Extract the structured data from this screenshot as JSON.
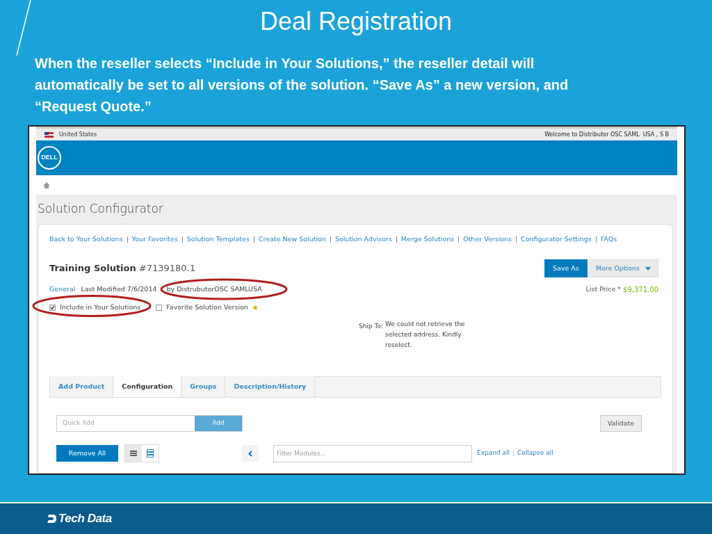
{
  "slide": {
    "title": "Deal Registration",
    "body": "When the reseller selects “Include in Your Solutions,” the reseller detail will automatically be set to all versions of the solution. “Save As” a new version, and “Request Quote.”",
    "footer_logo": "Tech Data"
  },
  "app": {
    "country": "United States",
    "welcome": "Welcome to Distributor OSC SAML  USA , S B",
    "logo": "DELL",
    "page_title": "Solution Configurator",
    "nav_links": [
      "Back to Your Solutions",
      "Your Favorites",
      "Solution Templates",
      "Create New Solution",
      "Solution Advisors",
      "Merge Solutions",
      "Other Versions",
      "Configurator Settings",
      "FAQs"
    ],
    "solution_name": "Training Solution",
    "solution_number": "#7139180.1",
    "general_link": "General",
    "last_modified": "Last Modified 7/6/2014",
    "modified_by": "by DistrubutorOSC SAMLUSA",
    "checkboxes": [
      {
        "label": "Include in Your Solutions",
        "checked": true,
        "starred": false
      },
      {
        "label": "Favorite Solution Version",
        "checked": false,
        "starred": true
      }
    ],
    "save_as": "Save As",
    "more_options": "More Options",
    "list_price_label": "List Price *",
    "list_price": "$9,371.00",
    "ship_to": {
      "label": "Ship To:",
      "message": "We could not retrieve the selected address. Kindly reselect."
    },
    "tabs": [
      {
        "label": "Add Product",
        "selected": false
      },
      {
        "label": "Configuration",
        "selected": true
      },
      {
        "label": "Groups",
        "selected": false
      },
      {
        "label": "Description/History",
        "selected": false
      }
    ],
    "quick_add": {
      "placeholder": "Quick Add",
      "button": "Add"
    },
    "validate": "Validate",
    "remove_all": "Remove All",
    "view_toggles": [
      {
        "kind": "list",
        "selected": true
      },
      {
        "kind": "rows",
        "selected": false
      }
    ],
    "filter": {
      "placeholder": "Filter Modules..."
    },
    "expand_all": "Expand all",
    "collapse_all": "Collapse all"
  }
}
